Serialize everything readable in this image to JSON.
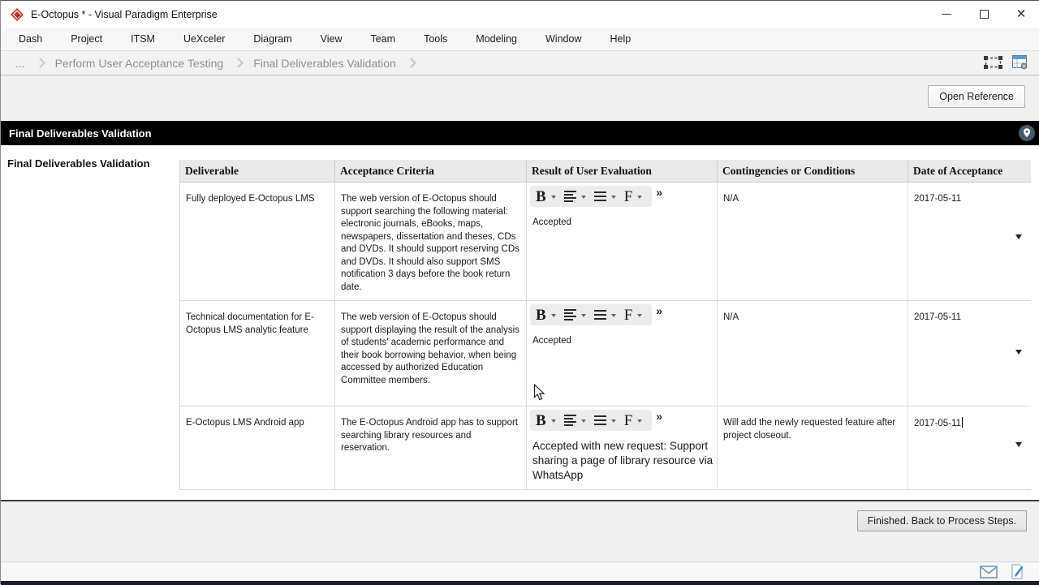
{
  "window": {
    "title": "E-Octopus * - Visual Paradigm Enterprise"
  },
  "menu": {
    "items": [
      "Dash",
      "Project",
      "ITSM",
      "UeXceler",
      "Diagram",
      "View",
      "Team",
      "Tools",
      "Modeling",
      "Window",
      "Help"
    ]
  },
  "breadcrumb": {
    "items": [
      "...",
      "Perform User Acceptance Testing",
      "Final Deliverables Validation"
    ]
  },
  "toolbar": {
    "open_reference_label": "Open Reference"
  },
  "section": {
    "title": "Final Deliverables Validation"
  },
  "panel": {
    "label": "Final Deliverables Validation"
  },
  "table": {
    "columns": [
      "Deliverable",
      "Acceptance Criteria",
      "Result of User Evaluation",
      "Contingencies or Conditions",
      "Date of Acceptance"
    ],
    "editor_toolbar": {
      "bold_label": "B",
      "font_label": "F",
      "overflow_label": "»"
    },
    "rows": [
      {
        "deliverable": "Fully deployed E-Octopus LMS",
        "acceptance_criteria": "The web version of E-Octopus should support searching the following material: electronic journals, eBooks, maps, newspapers, dissertation and theses, CDs and DVDs. It should support reserving CDs and DVDs. It should also support SMS notification 3 days before the book return date.",
        "result": "Accepted",
        "contingencies": "N/A",
        "date": "2017-05-11"
      },
      {
        "deliverable": "Technical documentation for E-Octopus LMS analytic feature",
        "acceptance_criteria": "The web version of E-Octopus should support displaying the result of the analysis of students' academic performance and their book borrowing behavior, when being accessed by authorized Education Committee members.",
        "result": "Accepted",
        "contingencies": "N/A",
        "date": "2017-05-11"
      },
      {
        "deliverable": "E-Octopus LMS Android app",
        "acceptance_criteria": "The E-Octopus Android app has to support searching library resources and reservation.",
        "result": "Accepted with new request: Support sharing a page of library resource via WhatsApp",
        "contingencies": "Will add the newly requested feature after project closeout.",
        "date": "2017-05-11"
      }
    ]
  },
  "footer": {
    "finished_button_label": "Finished. Back to Process Steps."
  },
  "icons": {
    "vp-logo": "red diamond",
    "minimize-icon": "–",
    "maximize-icon": "□",
    "close-icon": "✕",
    "fit-selection-icon": "dashed selection bounds",
    "form-window-icon": "blue form window",
    "location-pin-icon": "pin in circle",
    "bold-icon": "B",
    "align-icon": "align lines",
    "list-icon": "list lines",
    "font-icon": "F",
    "overflow-icon": "»",
    "dropdown-arrow-icon": "▾",
    "envelope-icon": "mail envelope",
    "edit-document-icon": "page with pencil",
    "mouse-cursor": "arrow pointer"
  },
  "colors": {
    "section_bar": "#000000",
    "header_bg": "#e9e9e9",
    "chrome_gray": "#f0f0f0",
    "icon_blue": "#4a87c0",
    "logo_red": "#c23b2e"
  }
}
